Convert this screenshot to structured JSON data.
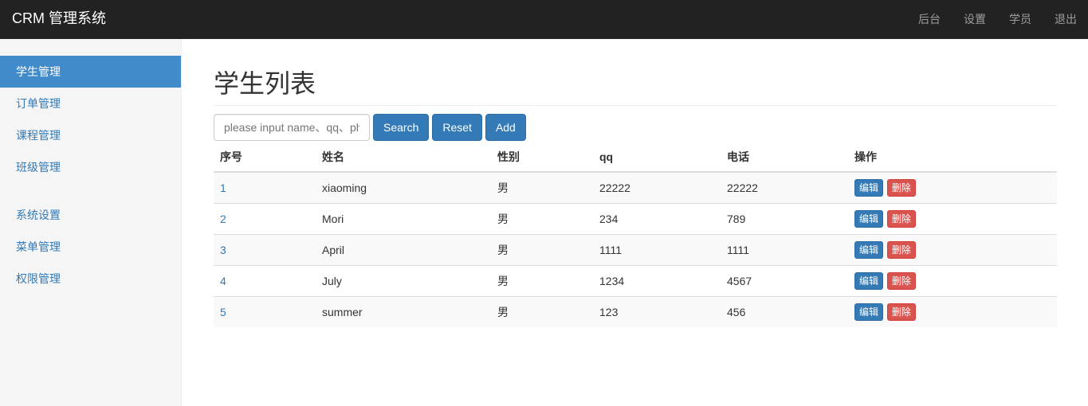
{
  "app": {
    "title": "CRM 管理系统"
  },
  "nav": {
    "items": [
      "后台",
      "设置",
      "学员",
      "退出"
    ]
  },
  "sidebar": {
    "group1": [
      "学生管理",
      "订单管理",
      "课程管理",
      "班级管理"
    ],
    "group2": [
      "系统设置",
      "菜单管理",
      "权限管理"
    ],
    "active": "学生管理"
  },
  "main": {
    "title": "学生列表",
    "search_placeholder": "please input name、qq、phone",
    "buttons": {
      "search": "Search",
      "reset": "Reset",
      "add": "Add"
    },
    "table": {
      "headers": [
        "序号",
        "姓名",
        "性别",
        "qq",
        "电话",
        "操作"
      ],
      "rows": [
        [
          "1",
          "xiaoming",
          "男",
          "22222",
          "22222"
        ],
        [
          "2",
          "Mori",
          "男",
          "234",
          "789"
        ],
        [
          "3",
          "April",
          "男",
          "1111",
          "1111"
        ],
        [
          "4",
          "July",
          "男",
          "1234",
          "4567"
        ],
        [
          "5",
          "summer",
          "男",
          "123",
          "456"
        ]
      ],
      "edit_label": "编辑",
      "delete_label": "删除"
    }
  },
  "colors": {
    "navbar": "#222222",
    "primary": "#337ab7",
    "danger": "#d9534f",
    "sidebar_active": "#428bca"
  }
}
